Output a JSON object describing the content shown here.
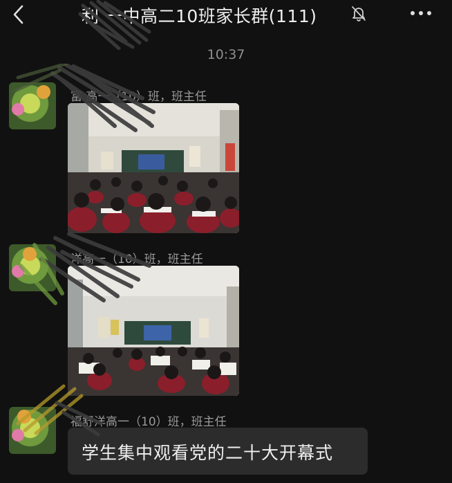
{
  "header": {
    "back_icon": "chevron-left-icon",
    "title": "利   一中高二10班家长群(111)",
    "mute_icon": "bell-muted-icon",
    "more_icon": "more-dots-icon"
  },
  "chat": {
    "timestamp": "10:37",
    "messages": [
      {
        "sender": "富   高一（10）班，班主任",
        "type": "image"
      },
      {
        "sender": "   洋高一（10）班，班主任",
        "type": "image"
      },
      {
        "sender": "福舒洋高一（10）班，班主任",
        "type": "text",
        "text": "学生集中观看党的二十大开幕式"
      }
    ]
  },
  "colors": {
    "background": "#111111",
    "bubble": "#2c2c2c",
    "classroom_uniform": "#8b1e2b"
  }
}
